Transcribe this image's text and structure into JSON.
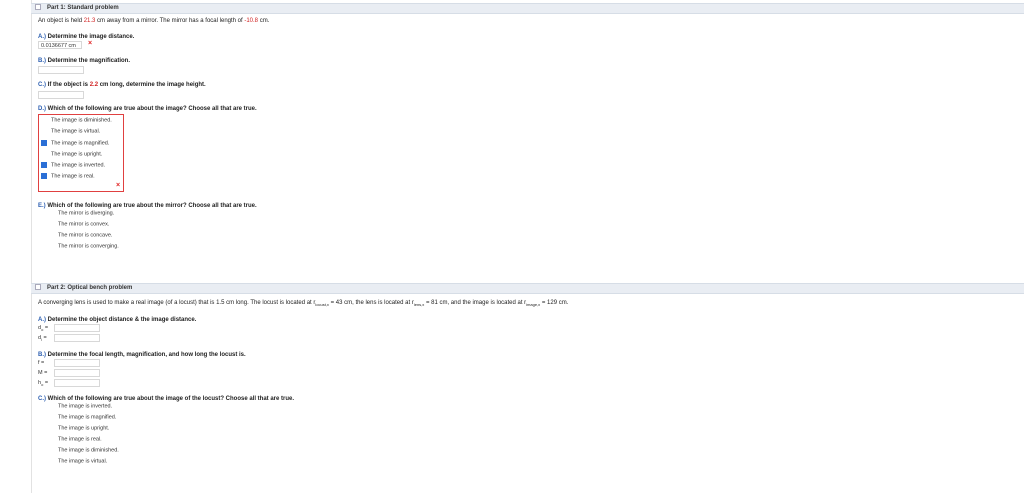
{
  "part1": {
    "header": "Part 1: Standard problem",
    "prompt_before": "An object is held ",
    "prompt_distance": "21.3",
    "prompt_mid": " cm away from a mirror. The mirror has a focal length of ",
    "prompt_focal": "-10.8",
    "prompt_after": " cm.",
    "qA": {
      "letter": "A.)",
      "text": " Determine the image distance.",
      "answer": "0.0136677 cm",
      "mark": "×"
    },
    "qB": {
      "letter": "B.)",
      "text": " Determine the magnification."
    },
    "qC": {
      "letter": "C.)",
      "text_before": " If the object is ",
      "height": "2.2",
      "text_after": " cm long, determine the image height."
    },
    "qD": {
      "letter": "D.)",
      "text": " Which of the following are true about the image? Choose all that are true.",
      "options": [
        {
          "label": "The image is diminished."
        },
        {
          "label": "The image is virtual."
        },
        {
          "label": "The image is magnified."
        },
        {
          "label": "The image is upright."
        },
        {
          "label": "The image is inverted."
        },
        {
          "label": "The image is real."
        }
      ],
      "mark": "×"
    },
    "qE": {
      "letter": "E.)",
      "text": " Which of the following are true about the mirror? Choose all that are true.",
      "options": [
        {
          "label": "The mirror is diverging."
        },
        {
          "label": "The mirror is convex."
        },
        {
          "label": "The mirror is concave."
        },
        {
          "label": "The mirror is converging."
        }
      ]
    }
  },
  "part2": {
    "header": "Part 2: Optical bench problem",
    "prompt_a": "A converging lens is used to make a real image (of a locust) that is 1.5 cm long. The locust is located at r",
    "prompt_sub1": "locust,x",
    "prompt_b": " = 43 cm, the lens is located at r",
    "prompt_sub2": "lens,x",
    "prompt_c": " = 81 cm, and the image is located at r",
    "prompt_sub3": "image,x",
    "prompt_d": " = 129 cm.",
    "qA": {
      "letter": "A.)",
      "text": " Determine the object distance & the image distance.",
      "v1": "d",
      "v1sub": "o",
      "v2": "d",
      "v2sub": "i",
      "eq": " ="
    },
    "qB": {
      "letter": "B.)",
      "text": " Determine the focal length, magnification, and how long the locust is.",
      "v1": "f =",
      "v2": "M =",
      "v3": "h",
      "v3sub": "o",
      "eq": " ="
    },
    "qC": {
      "letter": "C.)",
      "text": " Which of the following are true about the image of the locust? Choose all that are true.",
      "options": [
        {
          "label": "The image is inverted."
        },
        {
          "label": "The image is magnified."
        },
        {
          "label": "The image is upright."
        },
        {
          "label": "The image is real."
        },
        {
          "label": "The image is diminished."
        },
        {
          "label": "The image is virtual."
        }
      ]
    }
  },
  "colors": {
    "accent": "#2a5db0",
    "error": "#e02020",
    "checked": "#2a6fd6",
    "header_bg": "#e9edf3"
  }
}
